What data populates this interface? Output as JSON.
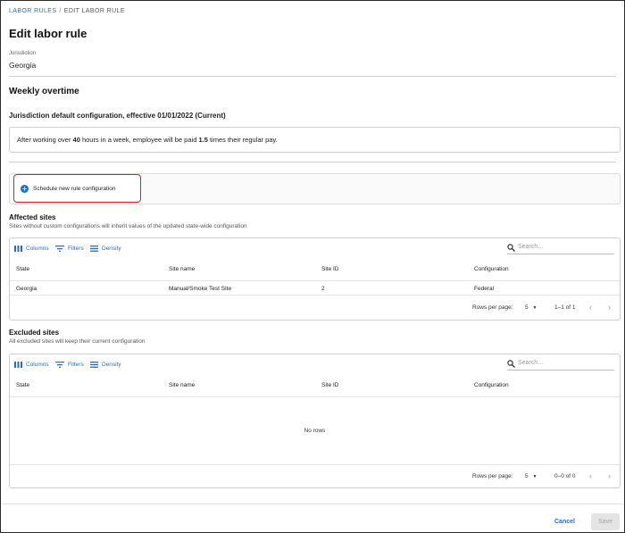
{
  "breadcrumb": {
    "parent": "LABOR RULES",
    "separator": "/",
    "current": "EDIT LABOR RULE"
  },
  "page_title": "Edit labor rule",
  "jurisdiction": {
    "label": "Jurisdiction",
    "value": "Georgia"
  },
  "section_title": "Weekly overtime",
  "config_heading": "Jurisdiction default configuration, effective 01/01/2022 (Current)",
  "summary": {
    "part1": "After working over ",
    "hours": "40",
    "part2": " hours in a week, employee will be paid ",
    "multiplier": "1.5",
    "part3": " times their regular pay."
  },
  "schedule_button": "Schedule new rule configuration",
  "affected": {
    "title": "Affected sites",
    "description": "Sites without custom configurations will inherit values of the updated state-wide configuration",
    "toolbar": {
      "columns": "Columns",
      "filters": "Filters",
      "density": "Density",
      "search_placeholder": "Search…"
    },
    "columns": [
      "State",
      "Site name",
      "Site ID",
      "Configuration"
    ],
    "rows": [
      {
        "state": "Georgia",
        "site_name": "Manual/Smoke Test Site",
        "site_id": "2",
        "configuration": "Federal"
      }
    ],
    "footer": {
      "rows_per_page_label": "Rows per page:",
      "rows_per_page": "5",
      "range": "1–1 of 1"
    }
  },
  "excluded": {
    "title": "Excluded sites",
    "description": "All excluded sites will keep their current configuration",
    "toolbar": {
      "columns": "Columns",
      "filters": "Filters",
      "density": "Density",
      "search_placeholder": "Search…"
    },
    "columns": [
      "State",
      "Site name",
      "Site ID",
      "Configuration"
    ],
    "empty_text": "No rows",
    "footer": {
      "rows_per_page_label": "Rows per page:",
      "rows_per_page": "5",
      "range": "0–0 of 0"
    }
  },
  "actions": {
    "cancel": "Cancel",
    "save": "Save"
  },
  "colors": {
    "accent": "#1f6fd1",
    "highlight_border": "#d2232a",
    "disabled_bg": "#e4e4e4"
  },
  "icons": [
    "columns-icon",
    "filter-icon",
    "density-icon",
    "search-icon",
    "plus-circle-icon",
    "chevron-left-icon",
    "chevron-right-icon",
    "dropdown-arrow-icon"
  ]
}
